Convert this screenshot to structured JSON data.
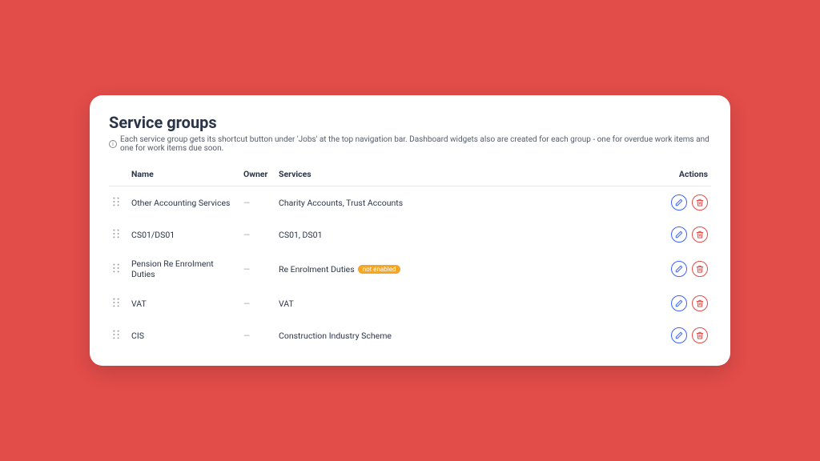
{
  "title": "Service groups",
  "description": "Each service group gets its shortcut button under 'Jobs' at the top navigation bar. Dashboard widgets also are created for each group - one for overdue work items and one for work items due soon.",
  "columns": {
    "name": "Name",
    "owner": "Owner",
    "services": "Services",
    "actions": "Actions"
  },
  "owner_placeholder": "—",
  "badge_text": "not enabled",
  "rows": [
    {
      "name": "Other Accounting Services",
      "services": "Charity Accounts,  Trust Accounts",
      "badge": false
    },
    {
      "name": "CS01/DS01",
      "services": "CS01,  DS01",
      "badge": false
    },
    {
      "name": "Pension Re Enrolment Duties",
      "services": "Re Enrolment Duties",
      "badge": true
    },
    {
      "name": "VAT",
      "services": "VAT",
      "badge": false
    },
    {
      "name": "CIS",
      "services": "Construction Industry Scheme",
      "badge": false
    }
  ]
}
